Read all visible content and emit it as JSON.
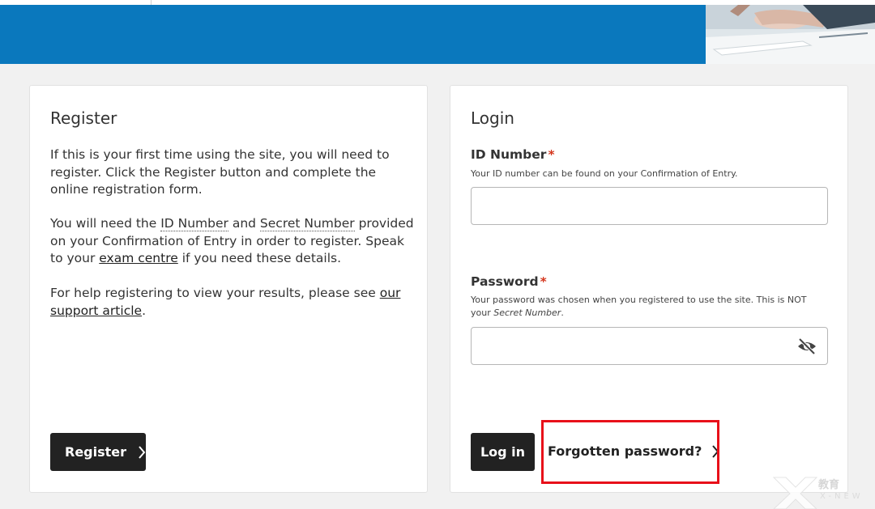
{
  "banner": {
    "color": "#0a78bd"
  },
  "register": {
    "title": "Register",
    "p1": "If this is your first time using the site, you will need to register. Click the Register button and complete the online registration form.",
    "p2_a": "You will need the ",
    "p2_id": "ID Number",
    "p2_and": " and ",
    "p2_secret": "Secret Number",
    "p2_b": " provided on your Confirmation of Entry in order to register. Speak to your ",
    "p2_link": "exam centre",
    "p2_c": " if you need these details.",
    "p3_a": "For help registering to view your results, please see ",
    "p3_link": "our support article",
    "p3_b": ".",
    "button_label": "Register"
  },
  "login": {
    "title": "Login",
    "id_label": "ID Number",
    "id_required": "*",
    "id_hint": "Your ID number can be found on your Confirmation of Entry.",
    "id_value": "",
    "password_label": "Password",
    "password_required": "*",
    "password_hint_a": "Your password was chosen when you registered to use the site. This is NOT your ",
    "password_hint_em": "Secret Number",
    "password_hint_b": ".",
    "password_value": "",
    "button_label": "Log in",
    "forgot_label": "Forgotten password?",
    "eye_icon": "eye-slash-icon"
  },
  "annotation": {
    "highlight_color": "#e8101a"
  },
  "watermark": {
    "text": "教育",
    "sub": "X-NEW"
  }
}
